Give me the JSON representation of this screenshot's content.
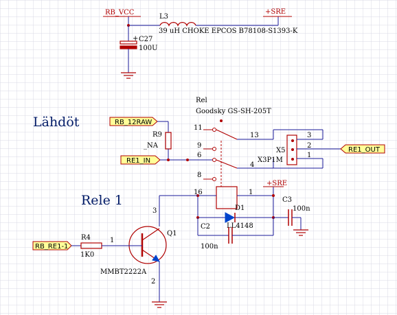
{
  "colors": {
    "grid": "#d9d9e6",
    "wire": "#1a1a99",
    "component": "#b00000",
    "port_fill": "#ffff99",
    "port_stroke": "#b00000",
    "text": "#000000",
    "title": "#001a66"
  },
  "titles": {
    "outputs": "Lähdöt",
    "relay": "Rele 1"
  },
  "power": {
    "rb_vcc": "RB_VCC",
    "sre_top": "+SRE",
    "sre_mid": "+SRE"
  },
  "ports": {
    "rb_12raw": "RB_12RAW",
    "re1_in": "RE1_IN",
    "re1_out": "RE1_OUT",
    "rb_re1": "RB_RE1-1"
  },
  "components": {
    "l3": {
      "ref": "L3",
      "value": "39 uH CHOKE EPCOS B78108-S1393-K"
    },
    "c27": {
      "ref": "C27",
      "value": "100U",
      "polarity": "+"
    },
    "rel": {
      "ref": "Rel",
      "value": "Goodsky GS-SH-205T"
    },
    "r9": {
      "ref": "R9",
      "value": "_NA"
    },
    "x5": {
      "ref": "X5",
      "value": "X3P1M"
    },
    "d1": {
      "ref": "D1",
      "value": "LL4148"
    },
    "c3": {
      "ref": "C3",
      "value": "100n"
    },
    "c2": {
      "ref": "C2",
      "value": "100n"
    },
    "r4": {
      "ref": "R4",
      "value": "1K0"
    },
    "q1": {
      "ref": "Q1",
      "value": "MMBT2222A"
    }
  },
  "pins": {
    "relay_11": "11",
    "relay_9": "9",
    "relay_6": "6",
    "relay_8": "8",
    "relay_13": "13",
    "relay_4": "4",
    "relay_16": "16",
    "relay_1": "1",
    "x5_3": "3",
    "x5_2": "2",
    "x5_1": "1",
    "q1_1": "1",
    "q1_2": "2",
    "q1_3": "3"
  }
}
